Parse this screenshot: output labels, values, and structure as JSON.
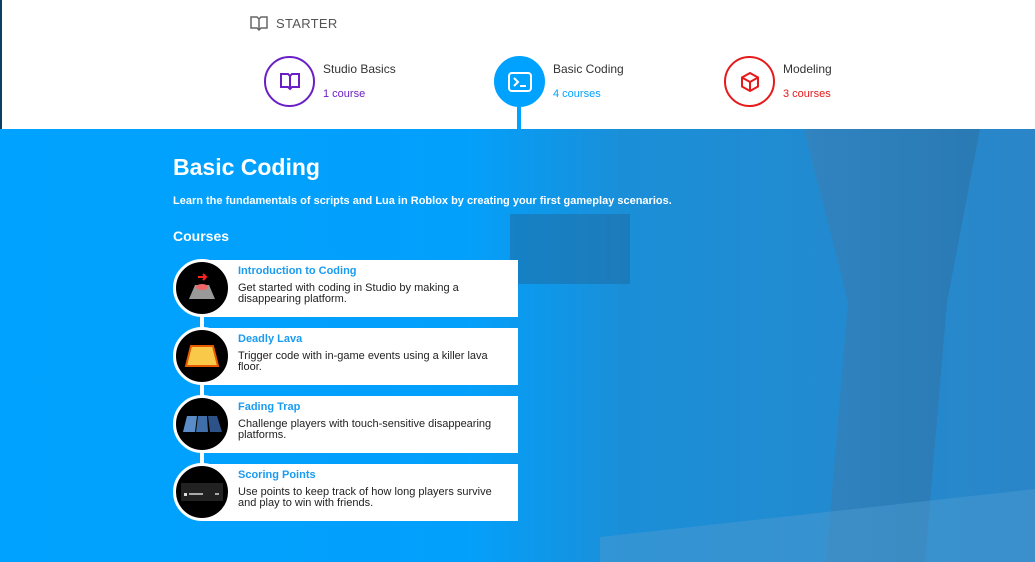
{
  "header": {
    "level": "STARTER"
  },
  "paths": [
    {
      "name": "Studio Basics",
      "count": "1 course",
      "color": "#6a1fc6"
    },
    {
      "name": "Basic Coding",
      "count": "4 courses",
      "color": "#00a2ff"
    },
    {
      "name": "Modeling",
      "count": "3 courses",
      "color": "#e61a1a"
    }
  ],
  "section": {
    "title": "Basic Coding",
    "description": "Learn the fundamentals of scripts and Lua in Roblox by creating your first gameplay scenarios.",
    "courses_heading": "Courses"
  },
  "courses": [
    {
      "title": "Introduction to Coding",
      "description": "Get started with coding in Studio by making a disappearing platform."
    },
    {
      "title": "Deadly Lava",
      "description": "Trigger code with in-game events using a killer lava floor."
    },
    {
      "title": "Fading Trap",
      "description": "Challenge players with touch-sensitive disappearing platforms."
    },
    {
      "title": "Scoring Points",
      "description": "Use points to keep track of how long players survive and play to win with friends."
    }
  ]
}
